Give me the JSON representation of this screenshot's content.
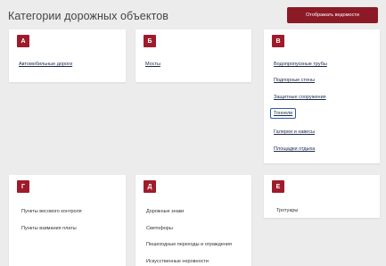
{
  "header": {
    "title": "Категории дорожных объектов",
    "button_label": "Отображать ведомости"
  },
  "cards": [
    {
      "letter": "А",
      "items": [
        "Автомобильные дороги"
      ]
    },
    {
      "letter": "Б",
      "items": [
        "Мосты"
      ]
    },
    {
      "letter": "В",
      "items": [
        "Водопропускные трубы",
        "Подпорные стены",
        "Защитные сооружения",
        "Тоннели",
        "Галереи и навесы",
        "Площадки отдыха"
      ]
    },
    {
      "letter": "Г",
      "items": [
        "Пункты весового контроля",
        "Пункты взимания платы"
      ]
    },
    {
      "letter": "Д",
      "items": [
        "Дорожные знаки",
        "Светофоры",
        "Пешеходные переходы и ограждения",
        "Искусственные неровности"
      ]
    },
    {
      "letter": "Е",
      "items": [
        "Тротуары"
      ]
    }
  ]
}
